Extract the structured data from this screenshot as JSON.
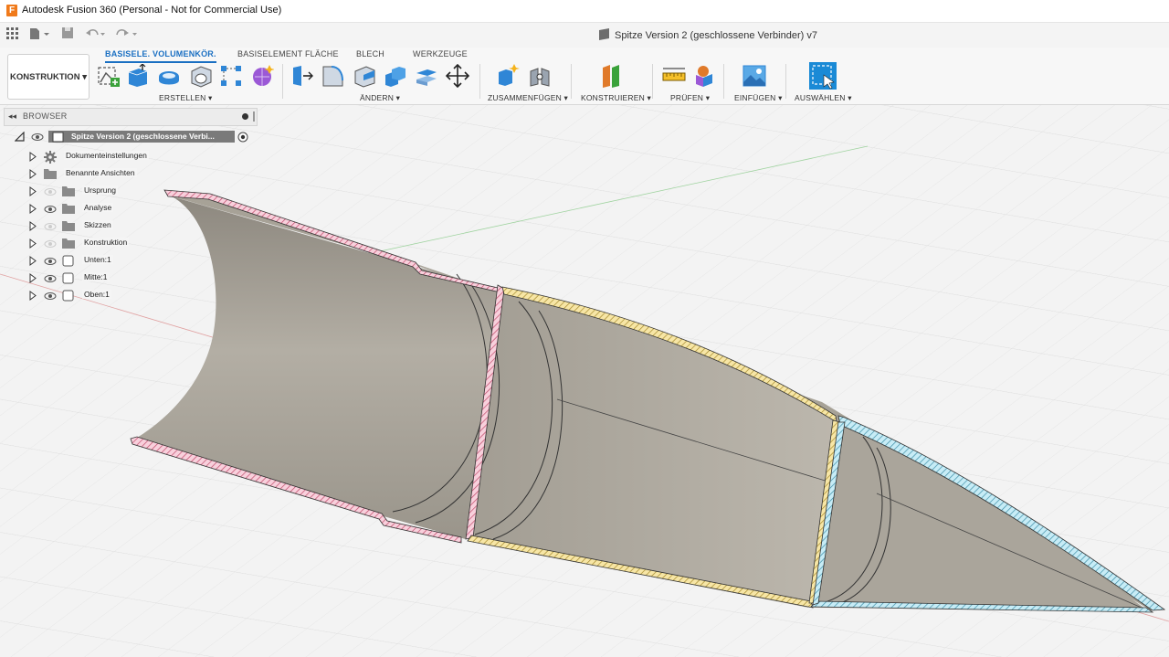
{
  "window": {
    "title": "Autodesk Fusion 360 (Personal - Not for Commercial Use)",
    "logo_letter": "F"
  },
  "document": {
    "title": "Spitze Version 2 (geschlossene Verbinder) v7"
  },
  "workspace": {
    "label": "KONSTRUKTION ▾"
  },
  "tabs": [
    {
      "label": "BASISELE. VOLUMENKÖR.",
      "active": true
    },
    {
      "label": "BASISELEMENT FLÄCHE",
      "active": false
    },
    {
      "label": "BLECH",
      "active": false
    },
    {
      "label": "WERKZEUGE",
      "active": false
    }
  ],
  "groups": {
    "erstellen": "ERSTELLEN ▾",
    "aendern": "ÄNDERN ▾",
    "zusammenfuegen": "ZUSAMMENFÜGEN ▾",
    "konstruieren": "KONSTRUIEREN ▾",
    "pruefen": "PRÜFEN ▾",
    "einfuegen": "EINFÜGEN ▾",
    "auswaehlen": "AUSWÄHLEN ▾"
  },
  "browser": {
    "title": "BROWSER",
    "root": "Spitze Version 2 (geschlossene Verbi...",
    "items": [
      {
        "label": "Dokumenteinstellungen",
        "icon": "gear-icon"
      },
      {
        "label": "Benannte Ansichten",
        "icon": "folder-icon"
      },
      {
        "label": "Ursprung",
        "icon": "folder-icon"
      },
      {
        "label": "Analyse",
        "icon": "folder-icon"
      },
      {
        "label": "Skizzen",
        "icon": "folder-icon"
      },
      {
        "label": "Konstruktion",
        "icon": "folder-icon"
      },
      {
        "label": "Unten:1",
        "icon": "component-icon"
      },
      {
        "label": "Mitte:1",
        "icon": "component-icon"
      },
      {
        "label": "Oben:1",
        "icon": "component-icon"
      }
    ]
  },
  "colors": {
    "accent": "#1a6fc2",
    "section_pink": "#f4b6c8",
    "section_yellow": "#f3dc8c",
    "section_cyan": "#a7e0f0",
    "body": "#a8a398"
  }
}
